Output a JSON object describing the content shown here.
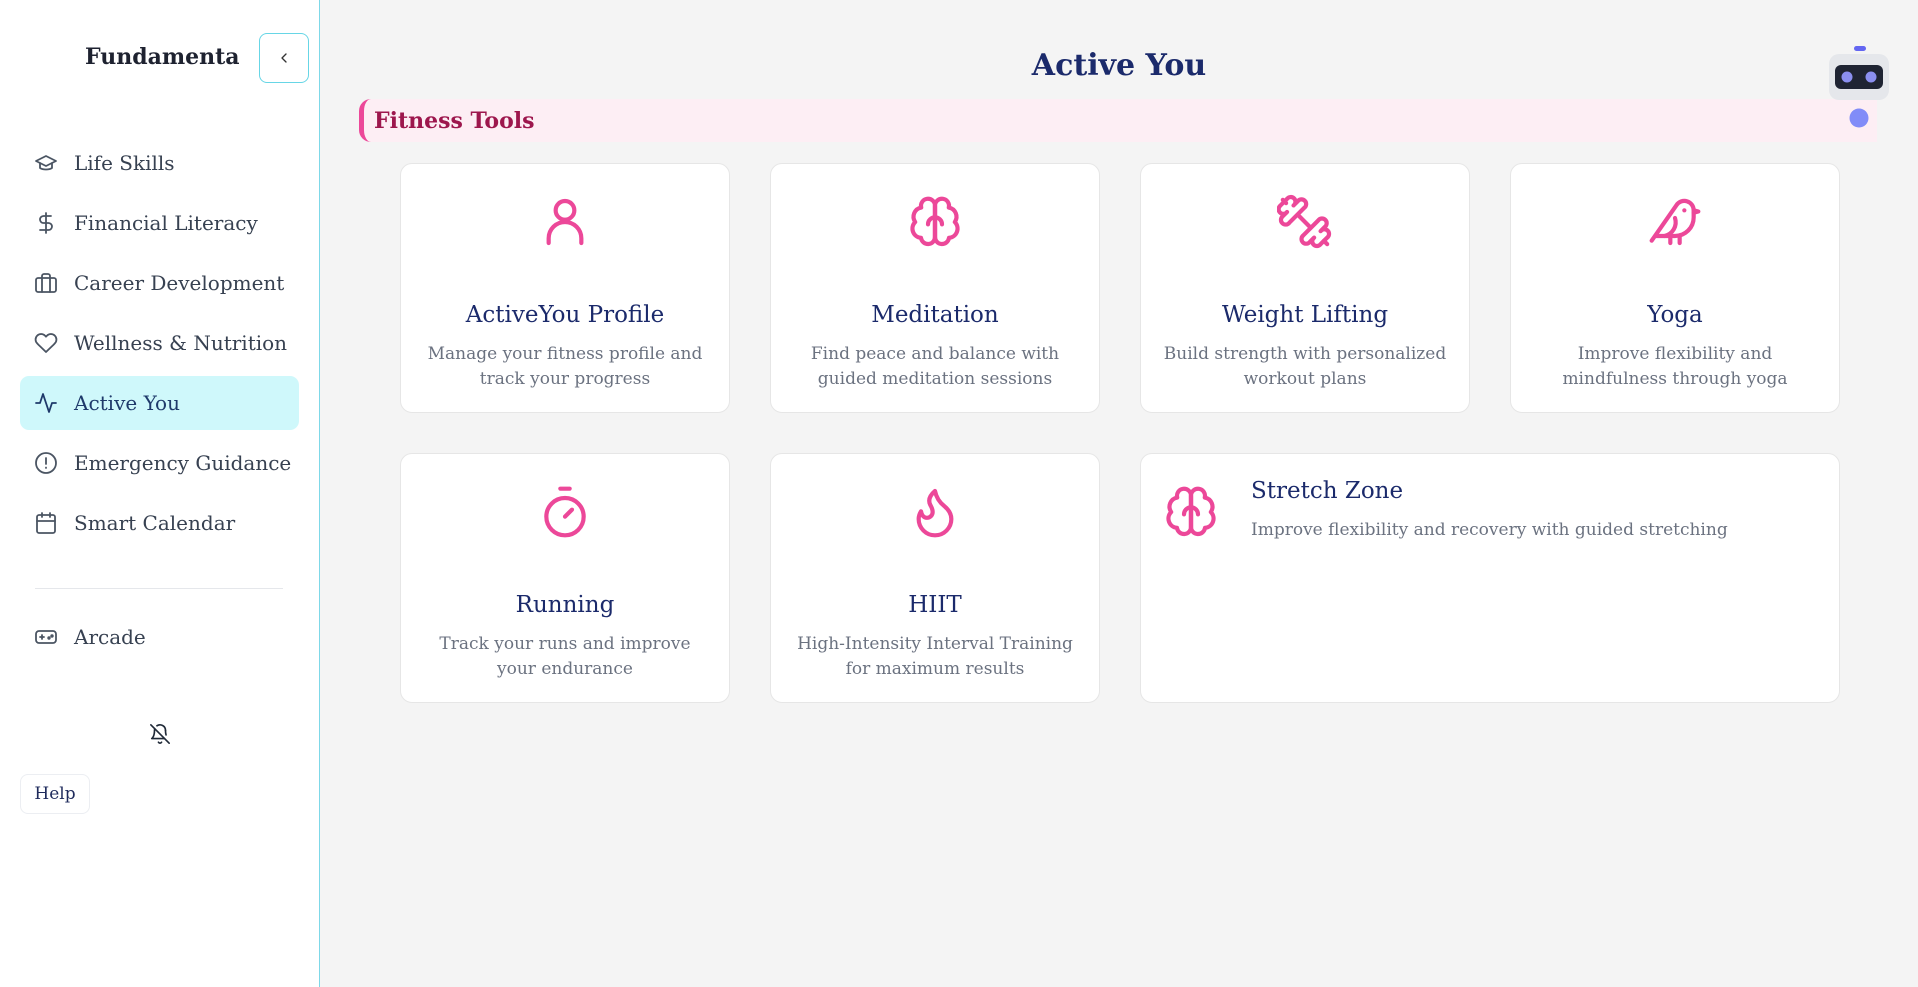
{
  "sidebar": {
    "brand": "Fundamenta",
    "items": [
      {
        "label": "Life Skills",
        "icon": "graduation-cap-icon"
      },
      {
        "label": "Financial Literacy",
        "icon": "dollar-icon"
      },
      {
        "label": "Career Development",
        "icon": "briefcase-icon"
      },
      {
        "label": "Wellness & Nutrition",
        "icon": "heart-icon"
      },
      {
        "label": "Active You",
        "icon": "activity-icon",
        "active": true
      },
      {
        "label": "Emergency Guidance",
        "icon": "alert-circle-icon"
      },
      {
        "label": "Smart Calendar",
        "icon": "calendar-icon"
      }
    ],
    "arcade": {
      "label": "Arcade",
      "icon": "gamepad-icon"
    },
    "help_label": "Help"
  },
  "main": {
    "title": "Active You",
    "section_title": "Fitness Tools",
    "cards": [
      {
        "title": "ActiveYou Profile",
        "desc": "Manage your fitness profile and track your progress",
        "icon": "user-icon"
      },
      {
        "title": "Meditation",
        "desc": "Find peace and balance with guided meditation sessions",
        "icon": "brain-icon"
      },
      {
        "title": "Weight Lifting",
        "desc": "Build strength with personalized workout plans",
        "icon": "dumbbell-icon"
      },
      {
        "title": "Yoga",
        "desc": "Improve flexibility and mindfulness through yoga",
        "icon": "bird-icon"
      },
      {
        "title": "Running",
        "desc": "Track your runs and improve your endurance",
        "icon": "timer-icon"
      },
      {
        "title": "HIIT",
        "desc": "High-Intensity Interval Training for maximum results",
        "icon": "flame-icon"
      },
      {
        "title": "Stretch Zone",
        "desc": "Improve flexibility and recovery with guided stretching",
        "icon": "brain-icon"
      }
    ]
  },
  "colors": {
    "accent": "#ec4899",
    "active_bg": "#cff8fb",
    "title": "#1b2a6b"
  }
}
